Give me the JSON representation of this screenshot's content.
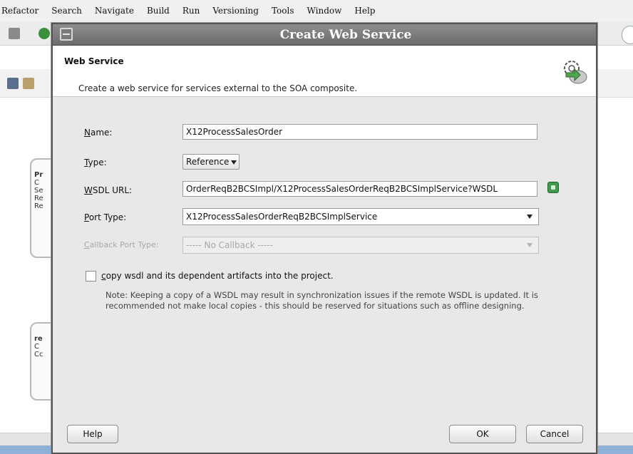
{
  "menubar": {
    "items": [
      "Refactor",
      "Search",
      "Navigate",
      "Build",
      "Run",
      "Versioning",
      "Tools",
      "Window",
      "Help"
    ],
    "mnemonics": [
      "t",
      "S",
      "N",
      "B",
      "R",
      "i",
      "T",
      "W",
      "H"
    ]
  },
  "background": {
    "nodes": [
      {
        "lines": [
          "Pr",
          "C",
          "Se",
          "Re",
          "Re"
        ]
      },
      {
        "lines": [
          "re",
          "C",
          "Cc"
        ]
      }
    ]
  },
  "dialog": {
    "title": "Create Web Service",
    "header": {
      "title": "Web Service",
      "description": "Create a web service for services external to the SOA composite.",
      "icon": "web-service-gears-icon"
    },
    "fields": {
      "name": {
        "label": "Name:",
        "value": "X12ProcessSalesOrder"
      },
      "type": {
        "label": "Type:",
        "value": "Reference"
      },
      "wsdl_url": {
        "label": "WSDL URL:",
        "value": "OrderReqB2BCSImpl/X12ProcessSalesOrderReqB2BCSImplService?WSDL"
      },
      "port_type": {
        "label": "Port Type:",
        "value": "X12ProcessSalesOrderReqB2BCSImplService"
      },
      "callback_port_type": {
        "label": "Callback Port Type:",
        "value": "----- No Callback -----"
      }
    },
    "copy_wsdl": {
      "label": "copy wsdl and its dependent artifacts into the project.",
      "checked": false
    },
    "note": "Note: Keeping a copy of a WSDL may result in synchronization issues if the remote WSDL is updated. It is recommended not make local copies - this should be reserved for situations such as offline designing.",
    "buttons": {
      "help": "Help",
      "ok": "OK",
      "cancel": "Cancel"
    }
  },
  "colors": {
    "titlebar": "#6c6c6c",
    "dialog_body": "#e8e8e8",
    "accent_green": "#3d9a4d"
  }
}
